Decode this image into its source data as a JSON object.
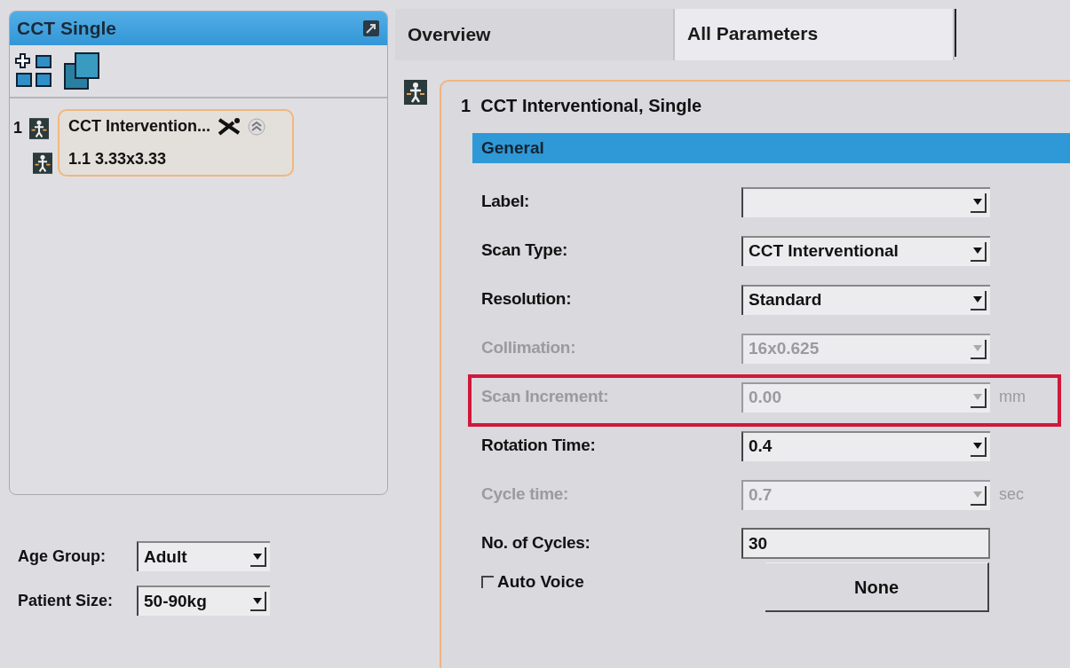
{
  "left_panel": {
    "title": "CCT Single",
    "tree": [
      {
        "number": "1",
        "label": "CCT Intervention...",
        "selected": true,
        "children": [
          {
            "label": "1.1 3.33x3.33"
          }
        ]
      }
    ],
    "fields": [
      {
        "label": "Age Group:",
        "value": "Adult"
      },
      {
        "label": "Patient Size:",
        "value": "50-90kg"
      }
    ]
  },
  "tabs": [
    {
      "label": "Overview",
      "selected": false
    },
    {
      "label": "All Parameters",
      "selected": true
    }
  ],
  "protocol": {
    "title": "1  CCT Interventional, Single",
    "section": "General",
    "rows": [
      {
        "kind": "select",
        "label": "Label:",
        "value": "",
        "disabled": false,
        "highlighted": false
      },
      {
        "kind": "select",
        "label": "Scan Type:",
        "value": "CCT Interventional",
        "disabled": false,
        "highlighted": false
      },
      {
        "kind": "select",
        "label": "Resolution:",
        "value": "Standard",
        "disabled": false,
        "highlighted": false
      },
      {
        "kind": "select",
        "label": "Collimation:",
        "value": "16x0.625",
        "disabled": true,
        "highlighted": false
      },
      {
        "kind": "select",
        "label": "Scan Increment:",
        "value": "0.00",
        "unit": "mm",
        "disabled": true,
        "highlighted": true
      },
      {
        "kind": "select",
        "label": "Rotation Time:",
        "value": "0.4",
        "disabled": false,
        "highlighted": false
      },
      {
        "kind": "select",
        "label": "Cycle time:",
        "value": "0.7",
        "unit": "sec",
        "disabled": true,
        "highlighted": false
      },
      {
        "kind": "text",
        "label": "No. of Cycles:",
        "value": "30",
        "disabled": false,
        "highlighted": false
      }
    ],
    "auto_voice": {
      "label": "Auto Voice",
      "checked": false
    },
    "voice_button": "None"
  }
}
